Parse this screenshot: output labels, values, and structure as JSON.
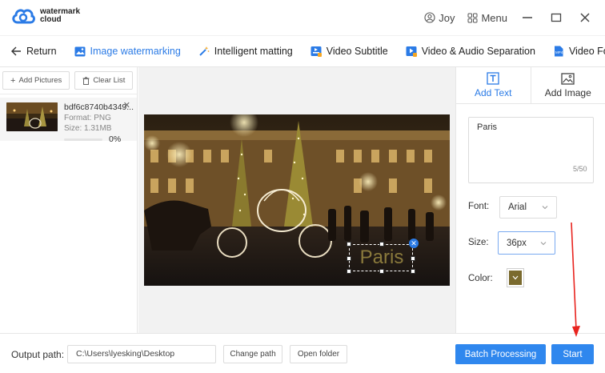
{
  "app": {
    "logo_line1": "watermark",
    "logo_line2": "cloud",
    "user_name": "Joy",
    "menu_label": "Menu",
    "brand_color": "#2b7be6"
  },
  "tabs": [
    {
      "label": "Return",
      "icon": "arrow-left-icon"
    },
    {
      "label": "Image watermarking",
      "icon": "image-icon",
      "active": true
    },
    {
      "label": "Intelligent matting",
      "icon": "magic-wand-icon"
    },
    {
      "label": "Video Subtitle",
      "icon": "video-subtitle-icon"
    },
    {
      "label": "Video & Audio Separation",
      "icon": "video-audio-icon"
    },
    {
      "label": "Video Form",
      "icon": "video-format-icon"
    }
  ],
  "left_panel": {
    "add_pictures": "Add Pictures",
    "clear_list": "Clear List",
    "file": {
      "name": "bdf6c8740b4349...",
      "format": "Format:  PNG",
      "size": "Size:  1.31MB",
      "progress": "0%",
      "progress_value": 0
    }
  },
  "watermark": {
    "text": "Paris",
    "color": "#7a6a2e"
  },
  "right_panel": {
    "tab_add_text": "Add Text",
    "tab_add_image": "Add Image",
    "text_value": "Paris",
    "char_count": "5/50",
    "font_label": "Font:",
    "font_value": "Arial",
    "size_label": "Size:",
    "size_value": "36px",
    "color_label": "Color:"
  },
  "bottom_bar": {
    "output_label": "Output path:",
    "output_path": "C:\\Users\\lyesking\\Desktop",
    "change_path": "Change path",
    "open_folder": "Open folder",
    "batch_processing": "Batch Processing",
    "start": "Start"
  }
}
